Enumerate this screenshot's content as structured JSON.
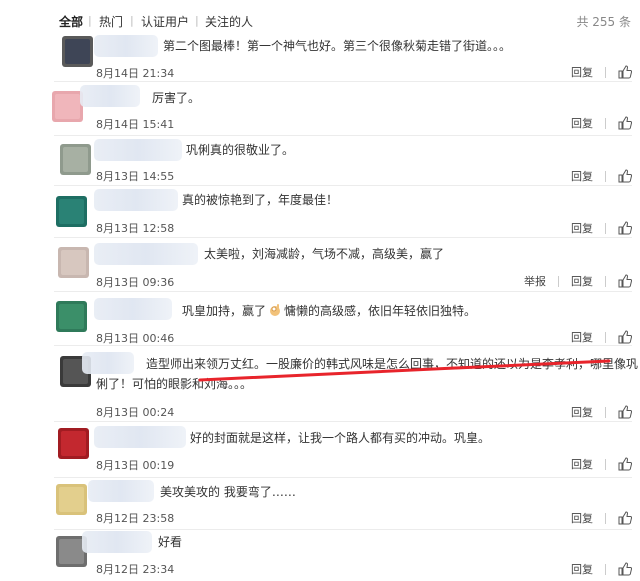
{
  "tabs": [
    "全部",
    "热门",
    "认证用户",
    "关注的人"
  ],
  "total": "共 255 条",
  "actions": {
    "reply": "回复",
    "report": "举报"
  },
  "colors": {
    "underline": "#e8242b"
  },
  "comments": [
    {
      "avatar": "#5a5a5a",
      "avatar_inner": "#3e4556",
      "text": "第二个图最棒！第一个神气也好。第三个很像秋菊走错了街道。。。",
      "time": "8月14日 21:34"
    },
    {
      "avatar": "#e8a7ad",
      "avatar_inner": "#f0b6bb",
      "text": "厉害了。",
      "time": "8月14日 15:41"
    },
    {
      "avatar": "#8f9a8d",
      "avatar_inner": "#a7b0a3",
      "text": "巩俐真的很敬业了。",
      "time": "8月13日 14:55"
    },
    {
      "avatar": "#1e6e63",
      "avatar_inner": "#2a8275",
      "text": "真的被惊艳到了，年度最佳！",
      "time": "8月13日 12:58"
    },
    {
      "avatar": "#c8b7b0",
      "avatar_inner": "#d7c7bf",
      "text": "太美啦，刘海减龄，气场不减，高级美，赢了",
      "time": "8月13日 09:36"
    },
    {
      "avatar": "#2f7a5a",
      "avatar_inner": "#3b8f69",
      "text_a": "巩皇加持，赢了",
      "text_b": "慵懒的高级感，依旧年轻依旧独特。",
      "emoji": "ok-hand-icon",
      "time": "8月13日 00:46"
    },
    {
      "avatar": "#3a3a3a",
      "avatar_inner": "#555555",
      "line1": "造型师出来领万丈红。一股廉价的韩式风味是怎么回事，不知道的还以为是李孝利，哪里像巩",
      "line2": "俐了！可怕的眼影和刘海。。。",
      "time": "8月13日 00:24"
    },
    {
      "avatar": "#a11c22",
      "avatar_inner": "#c3282f",
      "text": "好的封面就是这样，让我一个路人都有买的冲动。巩皇。",
      "time": "8月13日 00:19"
    },
    {
      "avatar": "#d9c27a",
      "avatar_inner": "#e3cf8d",
      "text": "美攻美攻的 我要弯了……",
      "time": "8月12日 23:58"
    },
    {
      "avatar": "#6e6e6e",
      "avatar_inner": "#8a8a8a",
      "text": "好看",
      "time": "8月12日 23:34"
    }
  ]
}
